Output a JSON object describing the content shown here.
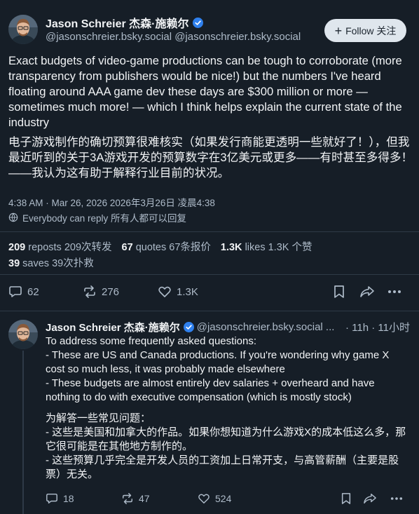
{
  "post": {
    "display_name": "Jason Schreier 杰森·施赖尔",
    "handle": "@jasonschreier.bsky.social @jasonschreier.bsky.social",
    "follow_label": "Follow 关注",
    "text_en": "Exact budgets of video-game productions can be tough to corroborate (more transparency from publishers would be nice!) but the numbers I've heard floating around AAA game dev these days are $300 million or more — sometimes much more! — which I think helps explain the current state of the industry",
    "text_zh": "电子游戏制作的确切预算很难核实（如果发行商能更透明一些就好了！），但我最近听到的关于3A游戏开发的预算数字在3亿美元或更多——有时甚至多得多！——我认为这有助于解释行业目前的状况。",
    "timestamp": "4:38 AM · Mar 26, 2026 2026年3月26日 凌晨4:38",
    "reply_setting": "Everybody can reply 所有人都可以回复",
    "stats": {
      "reposts_count": "209",
      "reposts_label": "reposts 209次转发",
      "quotes_count": "67",
      "quotes_label": "quotes 67条报价",
      "likes_count": "1.3K",
      "likes_label": "likes 1.3K 个赞",
      "saves_count": "39",
      "saves_label": "saves 39次扑救"
    },
    "actions": {
      "replies": "62",
      "reposts": "276",
      "likes": "1.3K"
    }
  },
  "reply": {
    "display_name": "Jason Schreier 杰森·施赖尔",
    "handle": "@jasonschreier.bsky.social ...",
    "time": "· 11h · 11小时",
    "lines": [
      "To address some frequently asked questions:",
      "- These are US and Canada productions. If you're wondering why game X cost so much less, it was probably made elsewhere",
      "- These budgets are almost entirely dev salaries + overheard and have nothing to do with executive compensation (which is mostly stock)",
      "",
      "为解答一些常见问题：",
      "- 这些是美国和加拿大的作品。如果你想知道为什么游戏X的成本低这么多，那它很可能是在其他地方制作的。",
      "- 这些预算几乎完全是开发人员的工资加上日常开支，与高管薪酬（主要是股票）无关。"
    ],
    "actions": {
      "replies": "18",
      "reposts": "47",
      "likes": "524"
    }
  },
  "colors": {
    "background": "#161e27",
    "text": "#f1f3f5",
    "muted": "#aebbc9",
    "verified": "#2f80ed",
    "divider": "#2e3a47",
    "follow_bg": "#dfe6ed"
  }
}
